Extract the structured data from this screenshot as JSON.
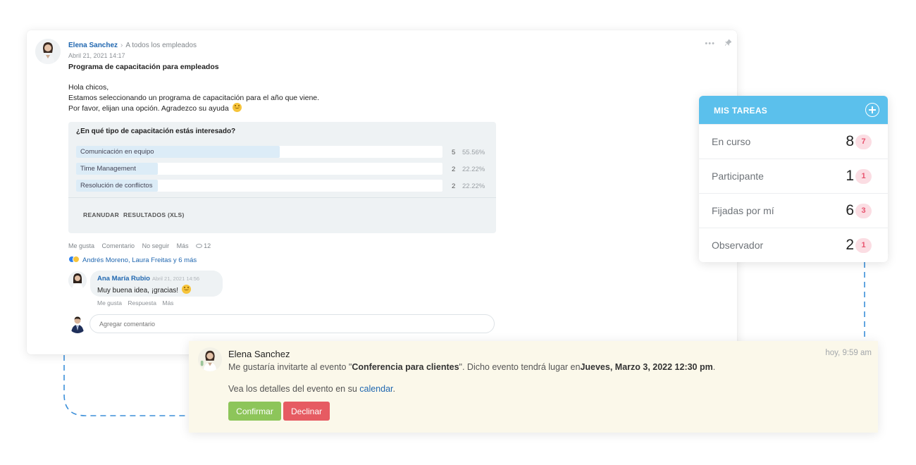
{
  "post": {
    "author": "Elena Sanchez",
    "audience": "A todos los empleados",
    "date": "Abril 21, 2021 14:17",
    "title": "Programa de capacitación para empleados",
    "body_lines": [
      "Hola chicos,",
      "Estamos seleccionando un programa de capacitación para el año que viene.",
      "Por favor, elijan una opción. Agradezco su ayuda"
    ],
    "menu_icon": "more-dots-icon",
    "pin_icon": "pin-icon",
    "poll": {
      "question": "¿En qué tipo de capacitación estás interesado?",
      "options": [
        {
          "label": "Comunicación en equipo",
          "count": "5",
          "percent": "55.56%",
          "fraction": 0.5556
        },
        {
          "label": "Time Management",
          "count": "2",
          "percent": "22.22%",
          "fraction": 0.2222
        },
        {
          "label": "Resolución de conflictos",
          "count": "2",
          "percent": "22.22%",
          "fraction": 0.2222
        }
      ],
      "resume_label": "REANUDAR",
      "results_label": "RESULTADOS (XLS)"
    },
    "actions": {
      "like": "Me gusta",
      "comment": "Comentario",
      "unfollow": "No seguir",
      "more": "Más",
      "views": "12"
    },
    "likes_text": "Andrés Moreno, Laura Freitas y 6 más",
    "comment": {
      "author": "Ana María Rubio",
      "date": "Abril 21, 2021 14:56",
      "text": "Muy buena idea, ¡gracias!",
      "like": "Me gusta",
      "reply": "Respuesta",
      "more": "Más"
    },
    "add_comment_placeholder": "Agregar comentario"
  },
  "tasks": {
    "title": "MIS TAREAS",
    "rows": [
      {
        "label": "En curso",
        "count": "8",
        "badge": "7"
      },
      {
        "label": "Participante",
        "count": "1",
        "badge": "1"
      },
      {
        "label": "Fijadas por mí",
        "count": "6",
        "badge": "3"
      },
      {
        "label": "Observador",
        "count": "2",
        "badge": "1"
      }
    ]
  },
  "invite": {
    "author": "Elena Sanchez",
    "time": "hoy, 9:59 am",
    "msg_prefix": "Me gustaría invitarte al evento \"",
    "event_name": "Conferencia para clientes",
    "msg_middle": "\". Dicho evento tendrá lugar en",
    "event_date": "Jueves, Marzo 3, 2022 12:30 pm",
    "msg_suffix": ".",
    "details_prefix": "Vea los detalles del evento en su ",
    "details_link": "calendar",
    "details_suffix": ".",
    "confirm_label": "Confirmar",
    "decline_label": "Declinar"
  },
  "colors": {
    "accent_blue": "#5bc0ec",
    "link_blue": "#2067b0",
    "confirm_green": "#8dc55a",
    "decline_red": "#e65b62",
    "badge_pink": "#fbdde3",
    "invite_bg": "#fbf8ea"
  }
}
